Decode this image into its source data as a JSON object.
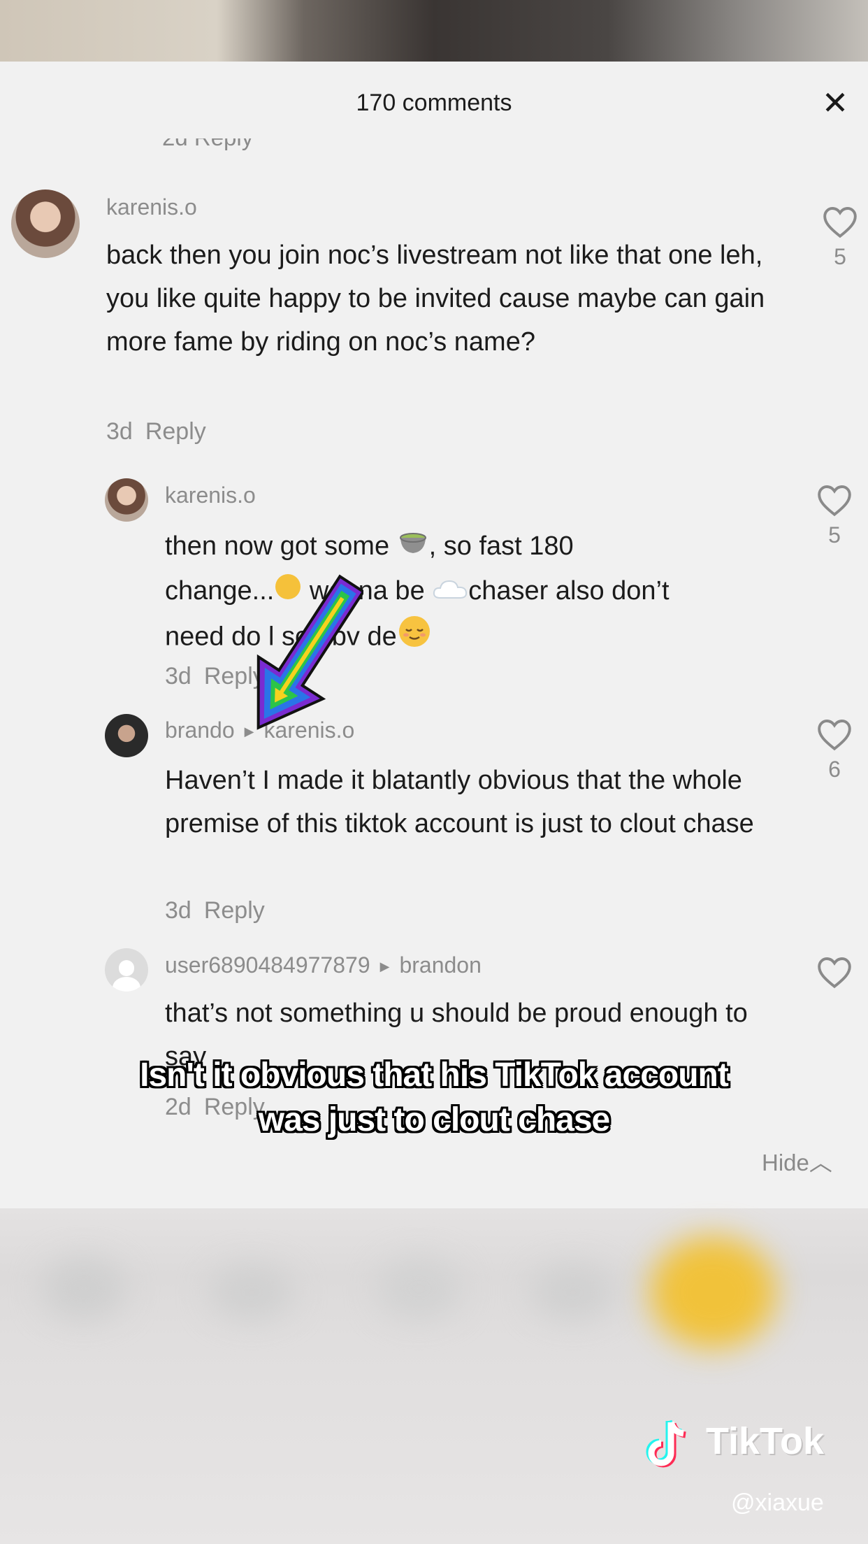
{
  "panel": {
    "title": "170 comments",
    "close_glyph": "✕",
    "cut_reply": "2d  Reply",
    "hide_label": "Hide",
    "hide_glyph": "︿"
  },
  "comments": [
    {
      "username": "karenis.o",
      "text": "back then you join noc’s livestream not like that one leh, you like quite happy to be invited cause maybe can gain more fame by riding on noc’s name?",
      "time": "3d",
      "reply_label": "Reply",
      "likes": "5"
    },
    {
      "username": "karenis.o",
      "text_parts": [
        "then now got some ",
        ", so fast 180",
        "change...",
        " wanna be ",
        "chaser also don’t",
        "need do",
        "l so obv de"
      ],
      "time": "3d",
      "reply_label": "Reply",
      "likes": "5"
    },
    {
      "username": "brando",
      "reply_to": "karenis.o",
      "text": "Haven’t I made it blatantly obvious that the whole premise of this tiktok account is just to clout chase",
      "time": "3d",
      "reply_label": "Reply",
      "likes": "6"
    },
    {
      "username": "user6890484977879",
      "reply_to": "brandon",
      "text": "that’s not something u should be proud enough to say",
      "time": "2d",
      "reply_label": "Reply",
      "likes": ""
    }
  ],
  "caption": {
    "line1": "Isn't it obvious that his TikTok account",
    "line2": "was just to clout chase"
  },
  "watermark": {
    "brand": "TikTok",
    "handle": "@xiaxue"
  },
  "colors": {
    "panel_bg": "#f1f1f1",
    "meta_gray": "#8c8c8c",
    "caption_text": "#ffffff"
  }
}
